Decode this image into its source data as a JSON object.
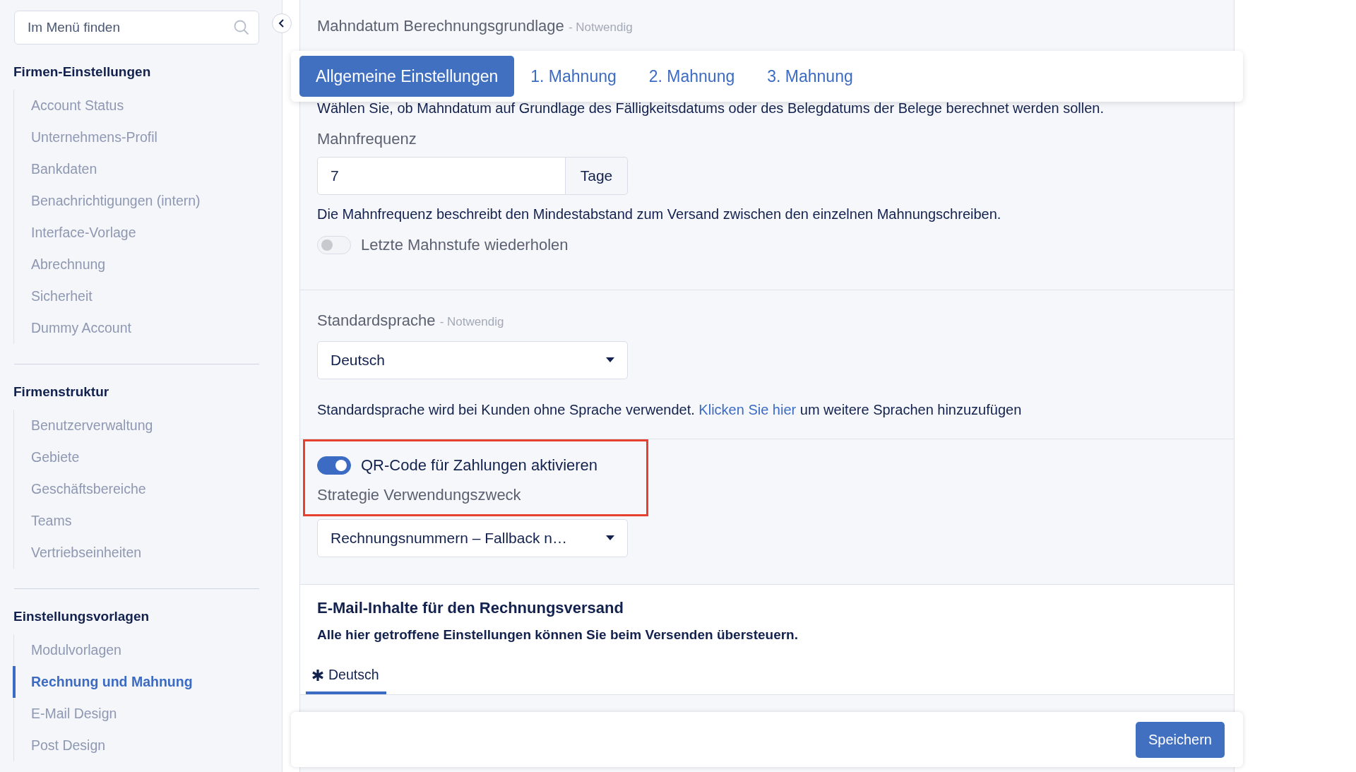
{
  "sidebar": {
    "search": {
      "placeholder": "Im Menü finden"
    },
    "groups": [
      {
        "title": "Firmen-Einstellungen",
        "items": [
          {
            "label": "Account Status",
            "selected": false
          },
          {
            "label": "Unternehmens-Profil",
            "selected": false
          },
          {
            "label": "Bankdaten",
            "selected": false
          },
          {
            "label": "Benachrichtigungen (intern)",
            "selected": false
          },
          {
            "label": "Interface-Vorlage",
            "selected": false
          },
          {
            "label": "Abrechnung",
            "selected": false
          },
          {
            "label": "Sicherheit",
            "selected": false
          },
          {
            "label": "Dummy Account",
            "selected": false
          }
        ]
      },
      {
        "title": "Firmenstruktur",
        "items": [
          {
            "label": "Benutzerverwaltung",
            "selected": false
          },
          {
            "label": "Gebiete",
            "selected": false
          },
          {
            "label": "Geschäftsbereiche",
            "selected": false
          },
          {
            "label": "Teams",
            "selected": false
          },
          {
            "label": "Vertriebseinheiten",
            "selected": false
          }
        ]
      },
      {
        "title": "Einstellungsvorlagen",
        "items": [
          {
            "label": "Modulvorlagen",
            "selected": false
          },
          {
            "label": "Rechnung und Mahnung",
            "selected": true
          },
          {
            "label": "E-Mail Design",
            "selected": false
          },
          {
            "label": "Post Design",
            "selected": false
          }
        ]
      }
    ]
  },
  "tabs": [
    {
      "label": "Allgemeine Einstellungen",
      "selected": true
    },
    {
      "label": "1. Mahnung",
      "selected": false
    },
    {
      "label": "2. Mahnung",
      "selected": false
    },
    {
      "label": "3. Mahnung",
      "selected": false
    }
  ],
  "due_date_basis": {
    "label": "Mahndatum Berechnungsgrundlage",
    "required": "- Notwendig",
    "help": "Wählen Sie, ob Mahndatum auf Grundlage des Fälligkeitsdatums oder des Belegdatums der Belege berechnet werden sollen."
  },
  "frequency": {
    "label": "Mahnfrequenz",
    "value": "7",
    "unit": "Tage",
    "help": "Die Mahnfrequenz beschreibt den Mindestabstand zum Versand zwischen den einzelnen Mahnungschreiben.",
    "repeat_toggle": {
      "label": "Letzte Mahnstufe wiederholen",
      "on": false
    }
  },
  "language": {
    "label": "Standardsprache",
    "required": "- Notwendig",
    "value": "Deutsch",
    "help_before": "Standardsprache wird bei Kunden ohne Sprache verwendet.",
    "link": "Klicken Sie hier",
    "help_after": "um weitere Sprachen hinzuzufügen"
  },
  "qr": {
    "highlighted": true,
    "toggle": {
      "label": "QR-Code für Zahlungen aktivieren",
      "on": true
    },
    "strategy_label": "Strategie Verwendungszweck",
    "strategy_value": "Rechnungsnummern – Fallback n…"
  },
  "email": {
    "title": "E-Mail-Inhalte für den Rechnungsversand",
    "subtitle": "Alle hier getroffene Einstellungen können Sie beim Versenden übersteuern.",
    "tabs": [
      {
        "label": "Deutsch",
        "selected": true
      }
    ]
  },
  "footer": {
    "save": "Speichern"
  }
}
